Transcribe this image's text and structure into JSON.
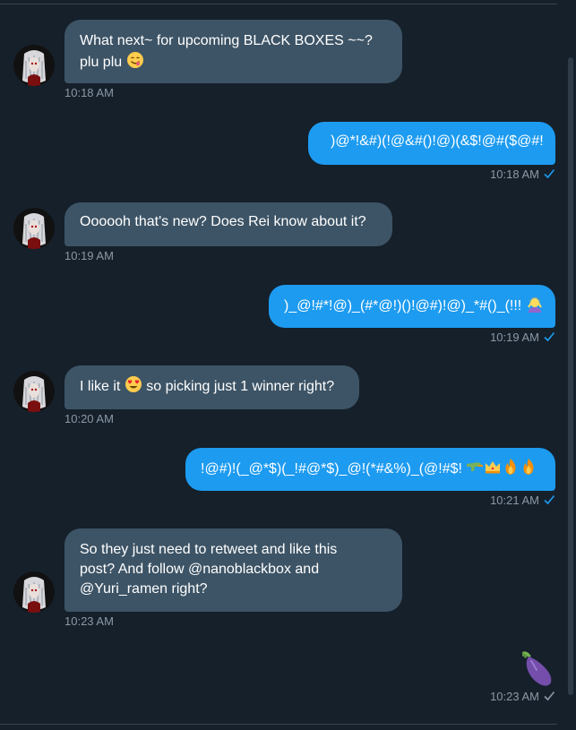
{
  "theme": {
    "background": "#15202b",
    "incoming_bubble": "#3d5466",
    "outgoing_bubble": "#1d9bf0",
    "timestamp": "#8b98a5",
    "read_check": "#1d9bf0"
  },
  "messages": [
    {
      "direction": "incoming",
      "lines": [
        "What next~ for upcoming BLACK BOXES ~~?",
        "plu plu"
      ],
      "emoji": "face-savoring-food",
      "time": "10:18 AM"
    },
    {
      "direction": "outgoing",
      "text": ")@*!&#)(!@&#()!@)(&$!@#($@#!",
      "time": "10:18 AM",
      "status": "read"
    },
    {
      "direction": "incoming",
      "text": "Oooooh that's new? Does Rei know about it?",
      "time": "10:19 AM"
    },
    {
      "direction": "outgoing",
      "text": ")_@!#*!@)_(#*@!)()!@#)!@)_*#()_(!!!",
      "emoji": "person-gesturing-ok",
      "time": "10:19 AM",
      "status": "read"
    },
    {
      "direction": "incoming",
      "text_before": "I like it",
      "emoji": "heart-eyes-face",
      "text_after": "so picking just 1 winner right?",
      "time": "10:20 AM"
    },
    {
      "direction": "outgoing",
      "text": "!@#)!(_@*$)(_!#@*$)_@!(*#&%)_(@!#$!",
      "emojis": [
        "water-pistol",
        "crown",
        "fire",
        "fire"
      ],
      "time": "10:21 AM",
      "status": "read"
    },
    {
      "direction": "incoming",
      "lines": [
        "So they just need to retweet and like this",
        "post? And follow @nanoblackbox and",
        "@Yuri_ramen right?"
      ],
      "time": "10:23 AM"
    },
    {
      "direction": "outgoing",
      "emoji": "eggplant",
      "time": "10:23 AM",
      "status": "sent"
    }
  ]
}
